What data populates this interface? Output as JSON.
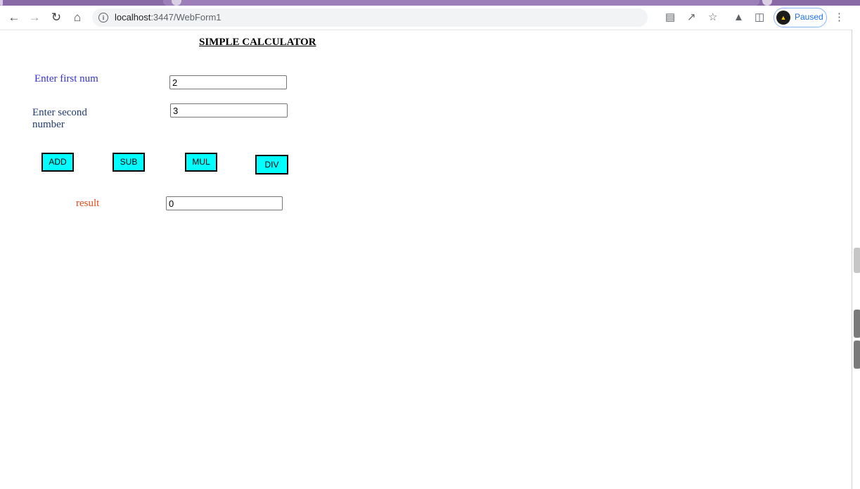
{
  "browser": {
    "url_host": "localhost",
    "url_path": ":3447/WebForm1",
    "profile_label": "Paused"
  },
  "calculator": {
    "title": "SIMPLE CALCULATOR",
    "first_label": "Enter first num",
    "second_label": "Enter second number",
    "result_label": "result",
    "first_value": "2",
    "second_value": "3",
    "result_value": "0",
    "buttons": {
      "add": "ADD",
      "sub": "SUB",
      "mul": "MUL",
      "div": "DIV"
    }
  },
  "colors": {
    "button_bg": "#00ffff",
    "first_label": "#3333cc",
    "second_label": "#1f3b73",
    "result_label": "#e04a1a"
  }
}
